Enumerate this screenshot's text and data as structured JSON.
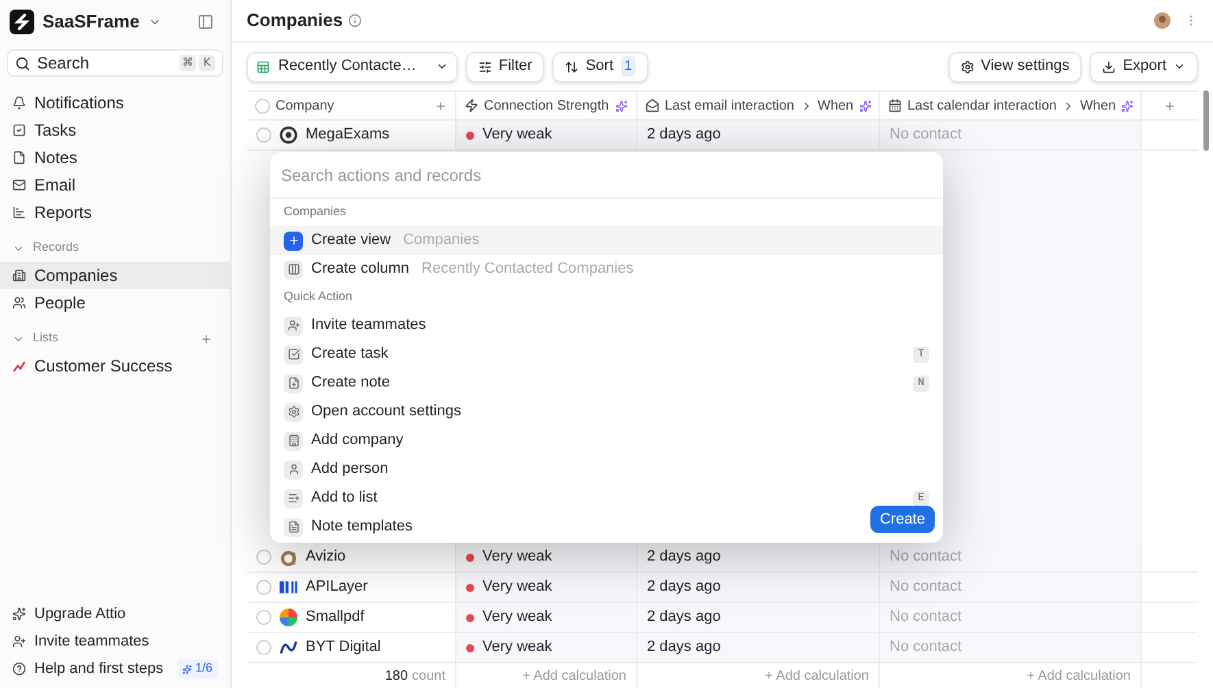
{
  "workspace": {
    "name": "SaaSFrame"
  },
  "search": {
    "label": "Search",
    "keys": [
      "⌘",
      "K"
    ]
  },
  "nav": [
    {
      "label": "Notifications",
      "selected": false
    },
    {
      "label": "Tasks",
      "selected": false
    },
    {
      "label": "Notes",
      "selected": false
    },
    {
      "label": "Email",
      "selected": false
    },
    {
      "label": "Reports",
      "selected": false
    }
  ],
  "records": {
    "title": "Records",
    "items": [
      {
        "label": "Companies",
        "selected": true
      },
      {
        "label": "People",
        "selected": false
      }
    ]
  },
  "lists": {
    "title": "Lists",
    "items": [
      {
        "label": "Customer Success",
        "selected": false
      }
    ]
  },
  "footer_links": [
    {
      "label": "Upgrade Attio"
    },
    {
      "label": "Invite teammates"
    },
    {
      "label": "Help and first steps",
      "badge": "1/6"
    }
  ],
  "page": {
    "title": "Companies"
  },
  "toolbar": {
    "view": "Recently Contacte…",
    "filter": "Filter",
    "sort": "Sort",
    "sort_count": "1",
    "view_settings": "View settings",
    "export": "Export"
  },
  "table": {
    "all_checked": false,
    "columns": [
      {
        "label": "Company"
      },
      {
        "label": "Connection Strength"
      },
      {
        "label": "Last email interaction",
        "sub": "When"
      },
      {
        "label": "Last calendar interaction",
        "sub": "When"
      }
    ],
    "rows_top": [
      {
        "checked": false,
        "company": "MegaExams",
        "strength": "Very weak",
        "email": "2 days ago",
        "calendar": "No contact"
      }
    ],
    "rows_bottom": [
      {
        "checked": false,
        "company": "Avizio",
        "strength": "Very weak",
        "email": "2 days ago",
        "calendar": "No contact"
      },
      {
        "checked": false,
        "company": "APILayer",
        "strength": "Very weak",
        "email": "2 days ago",
        "calendar": "No contact"
      },
      {
        "checked": false,
        "company": "Smallpdf",
        "strength": "Very weak",
        "email": "2 days ago",
        "calendar": "No contact"
      },
      {
        "checked": false,
        "company": "BYT Digital",
        "strength": "Very weak",
        "email": "2 days ago",
        "calendar": "No contact"
      }
    ],
    "footer": {
      "count": "180",
      "count_label": "count",
      "calcs": [
        "+ Add calculation",
        "+ Add calculation",
        "+ Add calculation"
      ]
    }
  },
  "palette": {
    "placeholder": "Search actions and records",
    "groups": [
      {
        "title": "Companies",
        "items": [
          {
            "label": "Create view",
            "context": "Companies",
            "selected": true
          },
          {
            "label": "Create column",
            "context": "Recently Contacted Companies",
            "selected": false
          }
        ]
      },
      {
        "title": "Quick Action",
        "items": [
          {
            "label": "Invite teammates",
            "selected": false
          },
          {
            "label": "Create task",
            "shortcut": "T",
            "selected": false
          },
          {
            "label": "Create note",
            "shortcut": "N",
            "selected": false
          },
          {
            "label": "Open account settings",
            "selected": false
          },
          {
            "label": "Add company",
            "selected": false
          },
          {
            "label": "Add person",
            "selected": false
          },
          {
            "label": "Add to list",
            "shortcut": "E",
            "selected": false
          },
          {
            "label": "Note templates",
            "selected": false
          }
        ]
      }
    ],
    "button": "Create"
  }
}
